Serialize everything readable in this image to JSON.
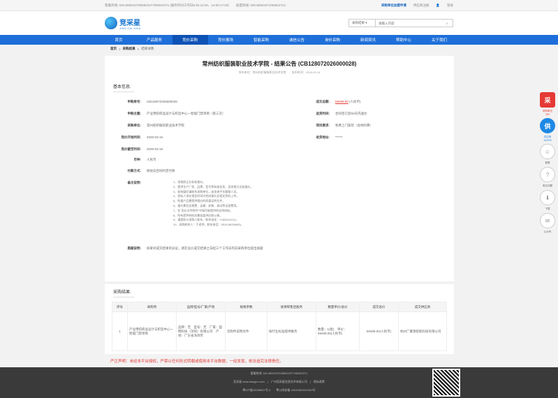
{
  "topbar": {
    "phone": "客服热线: 020-80922370/80922377/80922371 (服务时间工作日8:30-12:00、14:00-17:00)",
    "biz": "加盟热线: 020-80922371/80922713",
    "apply": "采购单位加盟申请",
    "feedback": "供应商注册",
    "login": "登录"
  },
  "logo": {
    "name": "竞采星",
    "sub": "JING CAI XING"
  },
  "search": {
    "select": "采购结果",
    "placeholder": "请输入内容"
  },
  "nav": [
    "首页",
    "产品服务",
    "竞价采购",
    "竞价展场",
    "智能采购",
    "诚信公告",
    "询价采购",
    "新闻资讯",
    "帮助中心",
    "关于我们"
  ],
  "breadcrumb": [
    "首页",
    "采购结果",
    "结果详情"
  ],
  "title": "常州纺织服装职业技术学院 - 结果公告 (CB128072026000028)",
  "subtitle": "发布单位：常州纺织服装职业技术学院　　发布时间：2026-03-19",
  "section1": "基本信息:",
  "info": {
    "k1": "申购单号:",
    "v1": "CB128072026000028",
    "k2": "申购主题:",
    "v2": "产业用纺织品设计与织造中心一智能门禁项目（第三次）",
    "k3": "采购单位:",
    "v3": "常州纺织服装职业技术学院",
    "k4": "竞价开始时间:",
    "v4": "2026-03-16",
    "k5": "竞价截至时间:",
    "v5": "2026-03-18",
    "k6": "币种:",
    "v6": "人民币",
    "k7": "付款方式:",
    "v7": "按协议合同约定付款",
    "k8": "备注说明:",
    "k9": "质疑说明:",
    "v9": "如果对成交结果有异议，请在竞价成交结果之日起三个工作日内向采购单位提出质疑",
    "r1": "成交总额:",
    "rv1": "59499.00",
    "rv1b": "(人民币)",
    "r2": "送货时间:",
    "rv2": "合同签订后60天内送达",
    "r3": "项目要求:",
    "rv3": "免费上门安装（含材料费）",
    "r4": "收货地址:",
    "rv4": "******"
  },
  "notes": [
    "1、须按照企业标准报价。",
    "2、提供生产厂家、品牌、型号等有效信息，否则视为无效报价。",
    "3、如有疑问请联系采购单位，或咨询平台客服人员。",
    "4、投标人须在规定时间内完成报价及相关资料上传。",
    "5、所报产品需提供相应的质量证明文件。",
    "6、报价需包含税费、运输、安装、调试等全部费用。",
    "7、在\"竞价文件附件\"中填写能提供的证明材料。",
    "8、所有提供材料均需加盖供应商公章。",
    "9、请提前与采购人联系，联系电话：17826111211。",
    "10、采购联系人：丁老师，联系电话：0519-86336003。"
  ],
  "section2": "采购结果:",
  "table": {
    "headers": [
      "序号",
      "采购项",
      "品牌/型号/厂家/产地",
      "规格参数",
      "质保和售后服务",
      "数量单价/总价",
      "成交总价",
      "成交供应商"
    ],
    "row": [
      "1",
      "产业用纺织品设计与织造中心一智能门禁项目",
      "品牌：无　型号：无　厂家：国网科技（深圳）有限公司　产地：广东省深圳市",
      "见附件说明文件",
      "按行业标准提供服务",
      "数量：1(批)　单价：59499.00(人民币)",
      "59499.00(人民币)",
      "杭州广厦源智能科技有限公司"
    ]
  },
  "warning": "严正声明：未经本平台授权，严禁以任何形式转载或使用本平台数据，一经发现，依法追究法律责任。",
  "footer": {
    "l1": "客服热线: 020-80922370/80922377/80922371",
    "l2": "竞采星 www.easyjcx.com　|　广州竞采星信息技术有限公司　|　隐私政策",
    "l3": "粤ICP备19036807号-2　　粤公网安备 44010602001349号"
  },
  "side": {
    "a": "采",
    "al": "采购单位\n399",
    "b": "供",
    "bl": "供应商\n181520",
    "c": "客服",
    "d": "常见问题",
    "e": "下载",
    "f": "公众号"
  }
}
